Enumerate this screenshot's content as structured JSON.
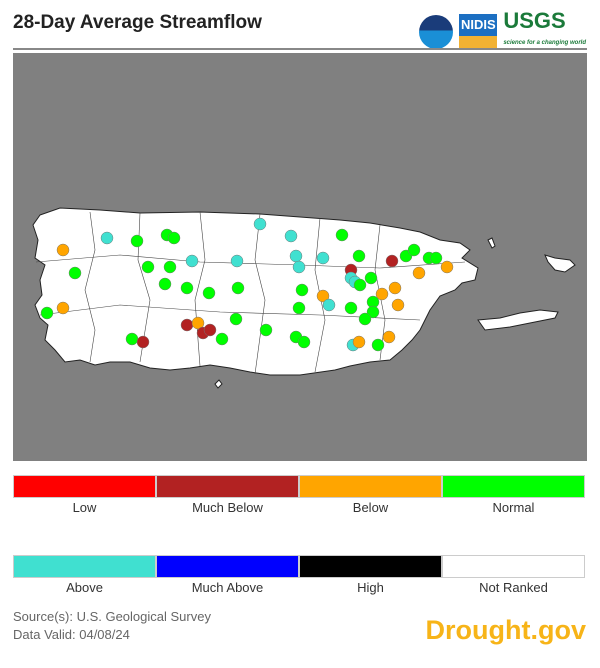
{
  "title": "28-Day Average Streamflow",
  "logos": {
    "noaa": "NOAA",
    "nidis": "NIDIS",
    "usgs": "USGS",
    "usgs_tagline": "science for a changing world"
  },
  "legend": [
    {
      "label": "Low",
      "color": "#ff0000"
    },
    {
      "label": "Much Below",
      "color": "#b22222"
    },
    {
      "label": "Below",
      "color": "#ffa500"
    },
    {
      "label": "Normal",
      "color": "#00ff00"
    },
    {
      "label": "Above",
      "color": "#40e0d0"
    },
    {
      "label": "Much Above",
      "color": "#0000ff"
    },
    {
      "label": "High",
      "color": "#000000"
    },
    {
      "label": "Not Ranked",
      "color": "#ffffff"
    }
  ],
  "map": {
    "background": "#808080",
    "region": "Puerto Rico",
    "gauges": [
      [
        "Above",
        107,
        238
      ],
      [
        "Below",
        63,
        250
      ],
      [
        "Normal",
        75,
        273
      ],
      [
        "Below",
        63,
        308
      ],
      [
        "Normal",
        47,
        313
      ],
      [
        "Normal",
        137,
        241
      ],
      [
        "Normal",
        167,
        235
      ],
      [
        "Normal",
        174,
        238
      ],
      [
        "Above",
        192,
        261
      ],
      [
        "Above",
        237,
        261
      ],
      [
        "Above",
        260,
        224
      ],
      [
        "Above",
        291,
        236
      ],
      [
        "Above",
        296,
        256
      ],
      [
        "Above",
        299,
        267
      ],
      [
        "Normal",
        148,
        267
      ],
      [
        "Normal",
        170,
        267
      ],
      [
        "Normal",
        165,
        284
      ],
      [
        "Normal",
        187,
        288
      ],
      [
        "Normal",
        209,
        293
      ],
      [
        "Normal",
        238,
        288
      ],
      [
        "Normal",
        302,
        290
      ],
      [
        "Normal",
        299,
        308
      ],
      [
        "Normal",
        236,
        319
      ],
      [
        "Normal",
        266,
        330
      ],
      [
        "Normal",
        296,
        337
      ],
      [
        "Normal",
        304,
        342
      ],
      [
        "Much Below",
        187,
        325
      ],
      [
        "Below",
        198,
        323
      ],
      [
        "Much Below",
        203,
        333
      ],
      [
        "Much Below",
        210,
        330
      ],
      [
        "Normal",
        222,
        339
      ],
      [
        "Normal",
        132,
        339
      ],
      [
        "Much Below",
        143,
        342
      ],
      [
        "Normal",
        342,
        235
      ],
      [
        "Above",
        323,
        258
      ],
      [
        "Normal",
        359,
        256
      ],
      [
        "Much Below",
        392,
        261
      ],
      [
        "Normal",
        406,
        256
      ],
      [
        "Normal",
        414,
        250
      ],
      [
        "Normal",
        429,
        258
      ],
      [
        "Normal",
        436,
        258
      ],
      [
        "Below",
        447,
        267
      ],
      [
        "Below",
        419,
        273
      ],
      [
        "Much Below",
        351,
        270
      ],
      [
        "Above",
        351,
        278
      ],
      [
        "Above",
        355,
        282
      ],
      [
        "Normal",
        360,
        285
      ],
      [
        "Normal",
        371,
        278
      ],
      [
        "Below",
        323,
        296
      ],
      [
        "Above",
        329,
        305
      ],
      [
        "Below",
        382,
        294
      ],
      [
        "Below",
        395,
        288
      ],
      [
        "Normal",
        373,
        302
      ],
      [
        "Normal",
        373,
        312
      ],
      [
        "Normal",
        351,
        308
      ],
      [
        "Normal",
        365,
        319
      ],
      [
        "Below",
        398,
        305
      ],
      [
        "Above",
        353,
        345
      ],
      [
        "Below",
        359,
        342
      ],
      [
        "Normal",
        378,
        345
      ],
      [
        "Below",
        389,
        337
      ]
    ]
  },
  "footer": {
    "source": "Source(s): U.S. Geological Survey",
    "valid": "Data Valid: 04/08/24",
    "brand": "Drought.gov"
  }
}
